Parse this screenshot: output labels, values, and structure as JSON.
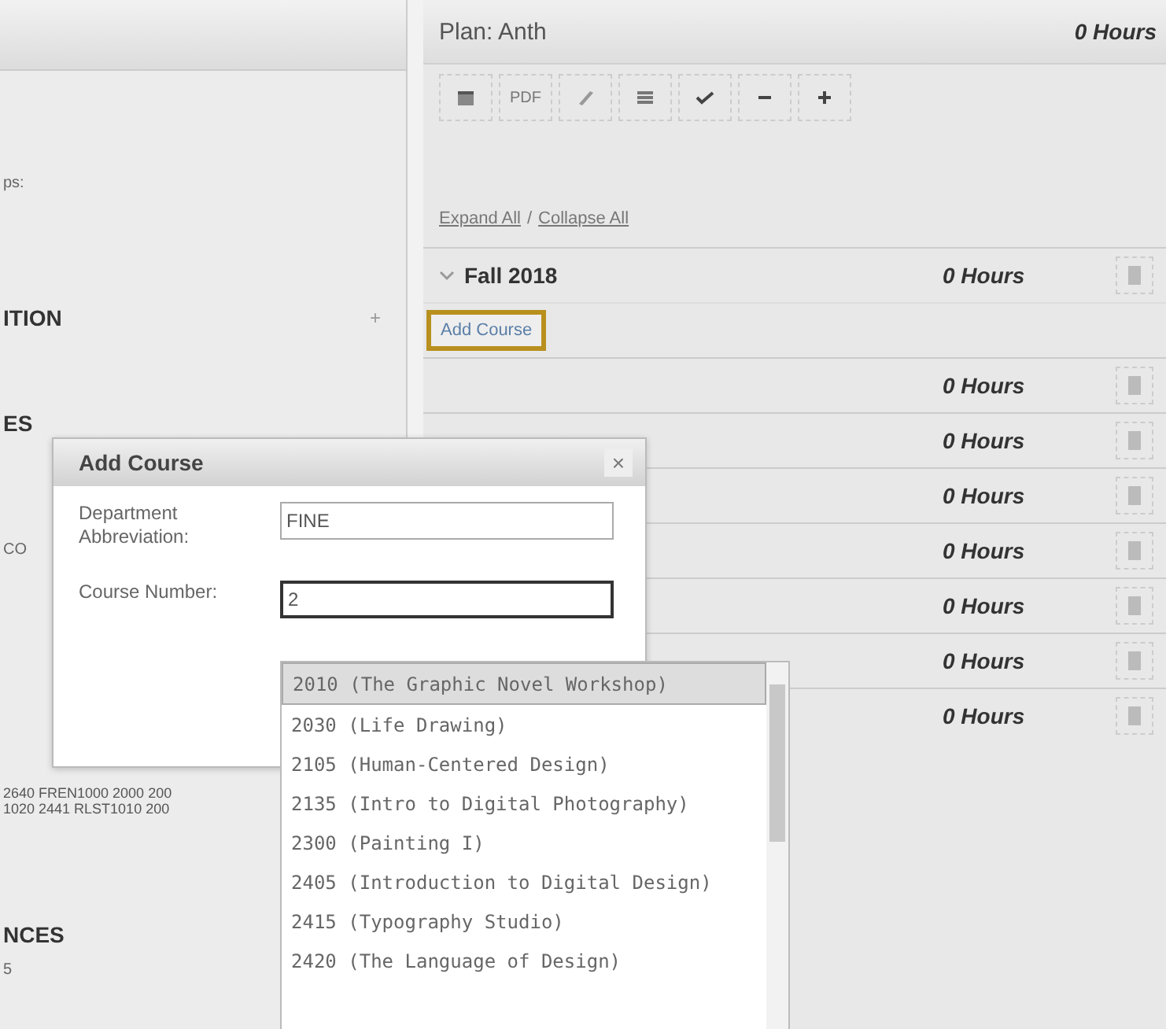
{
  "left_panel": {
    "fragments": [
      {
        "text": "ps:",
        "kind": "small"
      },
      {
        "text": "ITION",
        "kind": "heading"
      },
      {
        "text": "ES",
        "kind": "heading"
      },
      {
        "text": "CO",
        "kind": "small"
      },
      {
        "text": "2640 FREN1000 2000 200",
        "kind": "tiny"
      },
      {
        "text": "1020 2441 RLST1010 200",
        "kind": "tiny"
      },
      {
        "text": "NCES",
        "kind": "heading"
      },
      {
        "text": "5",
        "kind": "small"
      }
    ],
    "section_toggle": "+"
  },
  "plan": {
    "title": "Plan: Anth",
    "hours": "0 Hours",
    "toolbar": [
      {
        "kind": "calendar"
      },
      {
        "kind": "text",
        "label": "PDF"
      },
      {
        "kind": "pencil"
      },
      {
        "kind": "list"
      },
      {
        "kind": "check"
      },
      {
        "kind": "minus"
      },
      {
        "kind": "plus"
      }
    ],
    "expand_all": "Expand All",
    "separator": "/",
    "collapse_all": "Collapse All"
  },
  "terms": [
    {
      "name": "Fall 2018",
      "hours": "0 Hours",
      "expanded": true,
      "add_course": "Add Course"
    },
    {
      "hours": "0 Hours"
    },
    {
      "hours": "0 Hours"
    },
    {
      "hours": "0 Hours"
    },
    {
      "hours": "0 Hours"
    },
    {
      "hours": "0 Hours"
    },
    {
      "hours": "0 Hours"
    },
    {
      "hours": "0 Hours"
    }
  ],
  "dialog": {
    "title": "Add Course",
    "close": "×",
    "fields": [
      {
        "label": "Department Abbreviation:",
        "value": "FINE",
        "focused": false
      },
      {
        "label": "Course Number:",
        "value": "2",
        "focused": true
      }
    ]
  },
  "suggestions": [
    {
      "label": "2010 (The Graphic Novel Workshop)",
      "selected": true
    },
    {
      "label": "2030 (Life Drawing)",
      "selected": false
    },
    {
      "label": "2105 (Human-Centered Design)",
      "selected": false
    },
    {
      "label": "2135 (Intro to Digital Photography)",
      "selected": false
    },
    {
      "label": "2300 (Painting I)",
      "selected": false
    },
    {
      "label": "2405 (Introduction to Digital Design)",
      "selected": false
    },
    {
      "label": "2415 (Typography Studio)",
      "selected": false
    },
    {
      "label": "2420 (The Language of Design)",
      "selected": false
    }
  ]
}
